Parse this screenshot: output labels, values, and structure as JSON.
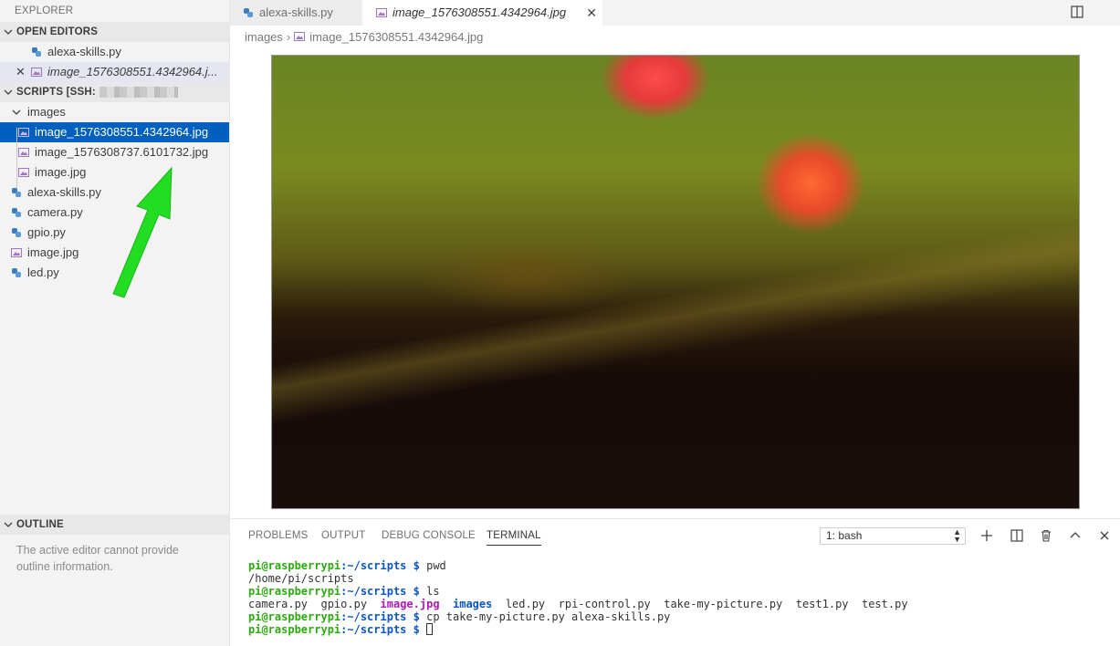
{
  "sidebar": {
    "explorer_title": "EXPLORER",
    "open_editors": {
      "header": "OPEN EDITORS",
      "items": [
        {
          "label": "alexa-skills.py",
          "type": "python"
        },
        {
          "label": "image_1576308551.4342964.j...",
          "type": "image"
        }
      ]
    },
    "scripts": {
      "header": "SCRIPTS [SSH:",
      "folder": "images",
      "folder_items": [
        {
          "label": "image_1576308551.4342964.jpg",
          "type": "image"
        },
        {
          "label": "image_1576308737.6101732.jpg",
          "type": "image"
        },
        {
          "label": "image.jpg",
          "type": "image"
        }
      ],
      "root_items": [
        {
          "label": "alexa-skills.py",
          "type": "python"
        },
        {
          "label": "camera.py",
          "type": "python"
        },
        {
          "label": "gpio.py",
          "type": "python"
        },
        {
          "label": "image.jpg",
          "type": "image"
        },
        {
          "label": "led.py",
          "type": "python"
        }
      ]
    },
    "outline": {
      "header": "OUTLINE",
      "message": "The active editor cannot provide outline information."
    }
  },
  "editor": {
    "tabs": [
      {
        "label": "alexa-skills.py",
        "type": "python",
        "active": false
      },
      {
        "label": "image_1576308551.4342964.jpg",
        "type": "image",
        "active": true
      }
    ],
    "close_glyph": "✕",
    "breadcrumb": {
      "folder": "images",
      "file": "image_1576308551.4342964.jpg"
    }
  },
  "panel": {
    "tabs": [
      "PROBLEMS",
      "OUTPUT",
      "DEBUG CONSOLE",
      "TERMINAL"
    ],
    "active_tab": "TERMINAL",
    "terminal_select": "1: bash",
    "terminal": {
      "prompt_user": "pi@raspberrypi",
      "prompt_path": ":~/scripts",
      "prompt_suffix": " $ ",
      "cmd1": "pwd",
      "out1": "/home/pi/scripts",
      "cmd2": "ls",
      "ls_items": [
        "camera.py",
        "gpio.py",
        "image.jpg",
        "images",
        "led.py",
        "rpi-control.py",
        "take-my-picture.py",
        "test1.py",
        "test.py"
      ],
      "cmd3": "cp take-my-picture.py alexa-skills.py"
    }
  },
  "colors": {
    "selection": "#0060c0",
    "arrow": "#22dd22",
    "prompt_green": "#2bab0e",
    "path_blue": "#0b56c4",
    "image_file_magenta": "#b018b8"
  }
}
